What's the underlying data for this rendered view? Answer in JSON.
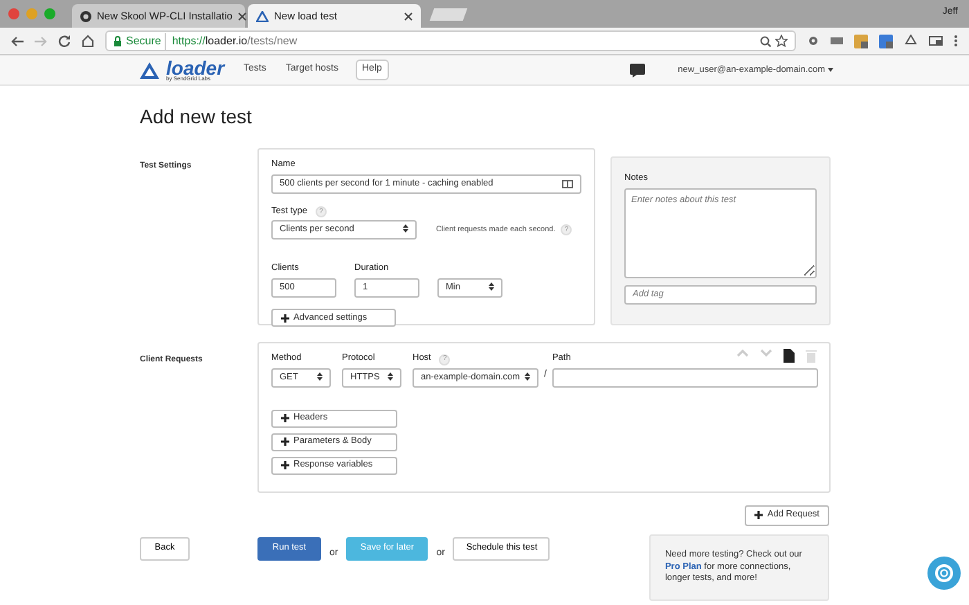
{
  "browser": {
    "tabs": [
      {
        "title": "New Skool WP-CLI Installatio",
        "selected": false
      },
      {
        "title": "New load test",
        "selected": true
      }
    ],
    "user": "Jeff",
    "secure_label": "Secure",
    "url_scheme": "https://",
    "url_host": "loader.io",
    "url_path": "/tests/new"
  },
  "app_nav": {
    "logo": "loader",
    "logo_sub": "by SendGrid Labs",
    "links": [
      {
        "label": "Tests",
        "kind": "link"
      },
      {
        "label": "Target hosts",
        "kind": "link"
      },
      {
        "label": "Help",
        "kind": "boxed"
      }
    ],
    "account": "new_user@an-example-domain.com"
  },
  "heading": "Add new test",
  "test_settings": {
    "label": "Test Settings",
    "name_label": "Name",
    "name_value": "500 clients per second for 1 minute - caching enabled",
    "type_label": "Test type",
    "type_help": "?",
    "type_value": "Clients per second",
    "type_hint": "Client requests made each second.",
    "hint_help": "?",
    "clients_label": "Clients",
    "clients_value": "500",
    "duration_label": "Duration",
    "duration_value": "1",
    "unit_value": "Min",
    "advanced": "Advanced settings"
  },
  "notes": {
    "label": "Notes",
    "placeholder": "Enter notes about this test",
    "tag_placeholder": "Add tag"
  },
  "client_requests": {
    "label": "Client Requests",
    "method_label": "Method",
    "method_value": "GET",
    "protocol_label": "Protocol",
    "protocol_value": "HTTPS",
    "host_label": "Host",
    "host_help": "?",
    "host_value": "an-example-domain.com",
    "separator": "/",
    "path_label": "Path",
    "sections": [
      "Headers",
      "Parameters & Body",
      "Response variables"
    ],
    "add_request": "Add Request"
  },
  "actions": {
    "back": "Back",
    "run": "Run test",
    "or_1": "or",
    "save": "Save for later",
    "or_2": "or",
    "schedule": "Schedule this test"
  },
  "promo": {
    "text_before": "Need more testing? Check out our",
    "link": "Pro Plan",
    "text_after": "for more connections, longer tests, and more!"
  }
}
